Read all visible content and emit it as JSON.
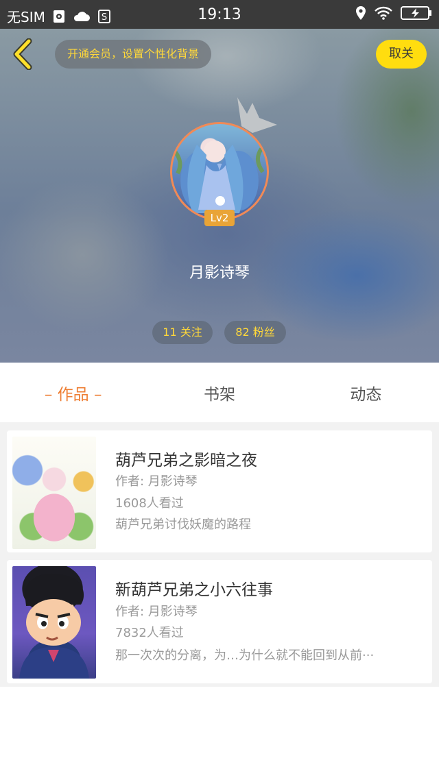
{
  "status_bar": {
    "carrier": "无SIM",
    "time": "19:13",
    "icons": [
      "settings-sim-icon",
      "cloud-icon",
      "s-box-icon",
      "location-icon",
      "wifi-icon",
      "battery-charging-icon"
    ]
  },
  "header": {
    "vip_prompt": "开通会员，设置个性化背景",
    "unfollow_label": "取关",
    "level_badge": "Lv2",
    "username": "月影诗琴",
    "following": "11 关注",
    "fans": "82 粉丝",
    "accent_color": "#ffdd0f"
  },
  "tabs": [
    {
      "label": "– 作品 –",
      "active": true
    },
    {
      "label": "书架",
      "active": false
    },
    {
      "label": "动态",
      "active": false
    }
  ],
  "works": [
    {
      "title": "葫芦兄弟之影暗之夜",
      "author": "作者: 月影诗琴",
      "views": "1608人看过",
      "description": "葫芦兄弟讨伐妖魔的路程"
    },
    {
      "title": "新葫芦兄弟之小六往事",
      "author": "作者: 月影诗琴",
      "views": "7832人看过",
      "description": "那一次次的分离，为…为什么就不能回到从前···"
    }
  ],
  "colors": {
    "active_tab": "#ee7e33",
    "level_badge": "#e9a437",
    "avatar_border": "#f08a57"
  }
}
